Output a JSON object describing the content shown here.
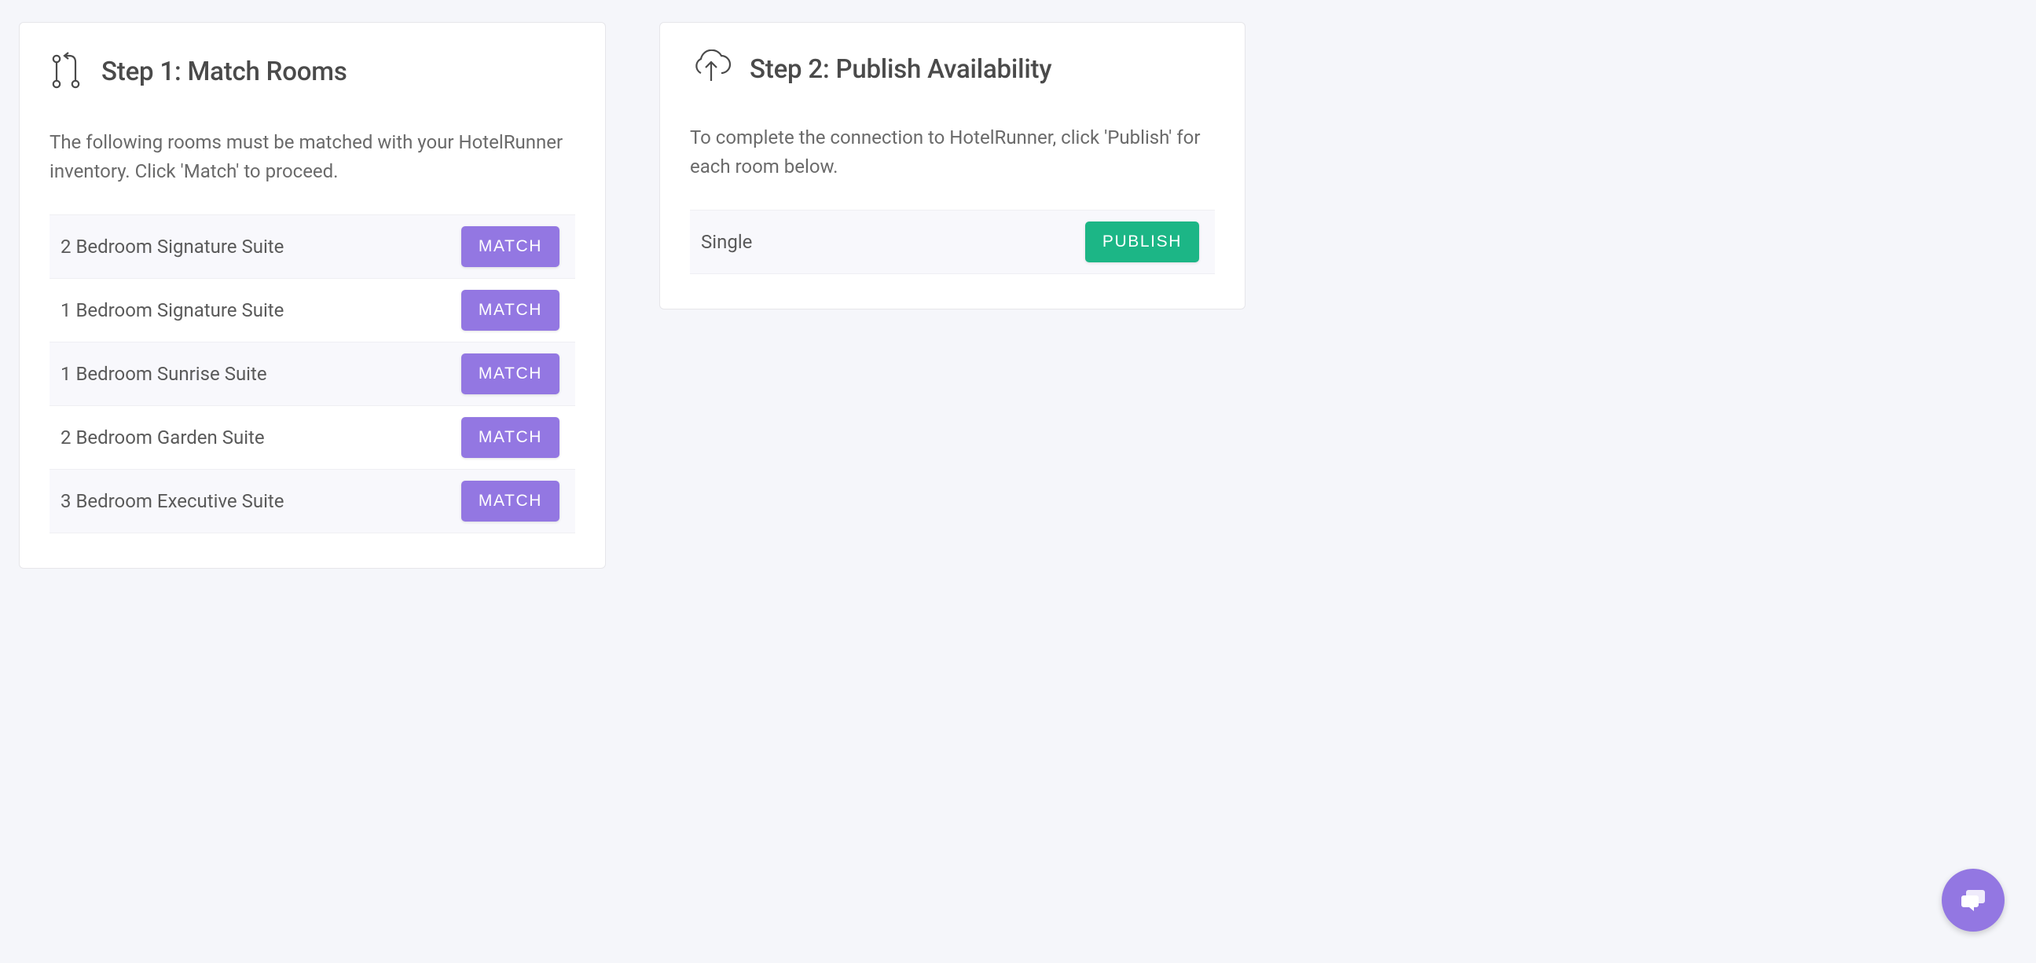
{
  "step1": {
    "title": "Step 1: Match Rooms",
    "description": "The following rooms must be matched with your HotelRunner inventory. Click 'Match' to proceed.",
    "button_label": "MATCH",
    "rooms": [
      {
        "name": "2 Bedroom Signature Suite"
      },
      {
        "name": "1 Bedroom Signature Suite"
      },
      {
        "name": "1 Bedroom Sunrise Suite"
      },
      {
        "name": "2 Bedroom Garden Suite"
      },
      {
        "name": "3 Bedroom Executive Suite"
      }
    ]
  },
  "step2": {
    "title": "Step 2: Publish Availability",
    "description": "To complete the connection to HotelRunner, click 'Publish' for each room below.",
    "button_label": "PUBLISH",
    "rooms": [
      {
        "name": "Single"
      }
    ]
  }
}
